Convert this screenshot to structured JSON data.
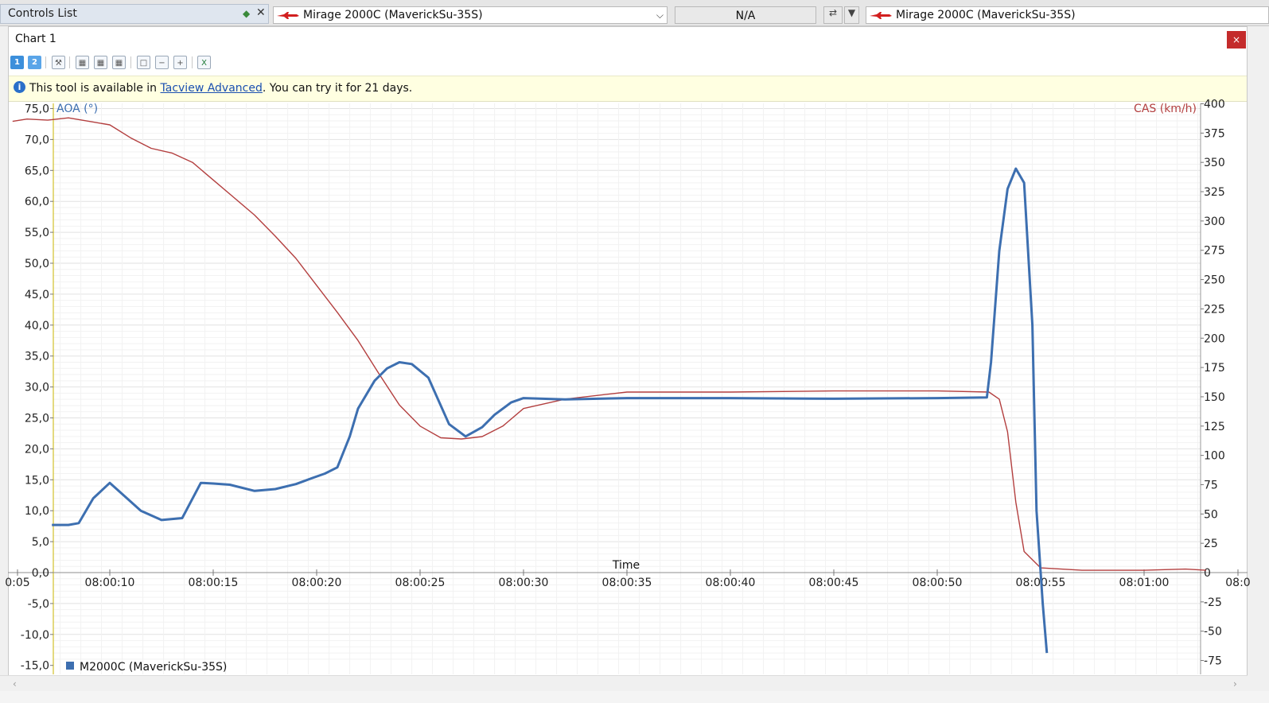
{
  "topbar": {
    "controls_title": "Controls List",
    "left_aircraft": "Mirage 2000C (MaverickSu-35S)",
    "middle_value": "N/A",
    "right_aircraft": "Mirage 2000C (MaverickSu-35S)"
  },
  "panel": {
    "title": "Chart 1",
    "close_symbol": "×"
  },
  "toolbar": {
    "btn1": "1",
    "btn2": "2"
  },
  "info": {
    "icon": "i",
    "prefix": "This tool is available in ",
    "link": "Tacview Advanced",
    "suffix": ". You can try it for 21 days."
  },
  "colors": {
    "aoa": "#3d6fb0",
    "cas": "#b33f3f",
    "grid": "#e6e6e6",
    "axis": "#9a9a9a"
  },
  "chart_data": {
    "type": "line",
    "xlabel": "Time",
    "x_ticks": [
      "0:05",
      "08:00:10",
      "08:00:15",
      "08:00:20",
      "08:00:25",
      "08:00:30",
      "08:00:35",
      "08:00:40",
      "08:00:45",
      "08:00:50",
      "08:00:55",
      "08:01:00",
      "08:0"
    ],
    "left_axis": {
      "label": "AOA (°)",
      "ylim": [
        -15,
        75
      ],
      "ticks": [
        "75,0",
        "70,0",
        "65,0",
        "60,0",
        "55,0",
        "50,0",
        "45,0",
        "40,0",
        "35,0",
        "30,0",
        "25,0",
        "20,0",
        "15,0",
        "10,0",
        "5,0",
        "0,0",
        "-5,0",
        "-10,0",
        "-15,0"
      ]
    },
    "right_axis": {
      "label": "CAS (km/h)",
      "ylim": [
        -75,
        400
      ],
      "ticks": [
        "400",
        "375",
        "350",
        "325",
        "300",
        "275",
        "250",
        "225",
        "200",
        "175",
        "150",
        "125",
        "100",
        "75",
        "50",
        "25",
        "0",
        "-25",
        "-50",
        "-75"
      ]
    },
    "legend": {
      "name": "M2000C (MaverickSu-35S)",
      "placement": "bottom-left"
    },
    "series": [
      {
        "name": "AOA (°)",
        "axis": "left",
        "x": [
          7.2,
          8,
          8.5,
          9.2,
          10,
          10.5,
          11.5,
          12.5,
          13.5,
          14.4,
          15,
          15.8,
          17,
          18,
          19,
          19.8,
          20.4,
          21,
          21.6,
          22,
          22.8,
          23.4,
          24,
          24.6,
          25.4,
          25.8,
          26.4,
          27.2,
          28,
          28.6,
          29.4,
          30,
          32,
          35,
          40,
          45,
          50,
          52.4,
          52.6,
          53,
          53.4,
          53.8,
          54.2,
          54.6,
          54.8,
          55.1,
          55.3
        ],
        "y": [
          7.7,
          7.7,
          8,
          12,
          14.5,
          13,
          10,
          8.5,
          8.8,
          14.5,
          14.4,
          14.2,
          13.2,
          13.5,
          14.3,
          15.3,
          16,
          17,
          22,
          26.5,
          31,
          33,
          34,
          33.7,
          31.5,
          28.5,
          24,
          22,
          23.5,
          25.5,
          27.5,
          28.2,
          28,
          28.2,
          28.2,
          28.1,
          28.2,
          28.3,
          34,
          52,
          62,
          65.3,
          63,
          40,
          10,
          -5,
          -13
        ]
      },
      {
        "name": "CAS (km/h)",
        "axis": "right",
        "x": [
          5.3,
          6,
          7,
          8,
          9,
          10,
          11,
          12,
          13,
          14,
          15,
          16,
          17,
          18,
          19,
          20,
          21,
          22,
          23,
          24,
          25,
          26,
          27,
          28,
          29,
          30,
          32,
          35,
          40,
          45,
          50,
          52.5,
          53,
          53.4,
          53.8,
          54.2,
          55,
          57,
          60,
          62,
          63
        ],
        "y": [
          385,
          387,
          386,
          388,
          385,
          382,
          371,
          362,
          358,
          350,
          335,
          320,
          305,
          287,
          268,
          245,
          222,
          198,
          170,
          143,
          125,
          115,
          114,
          116,
          125,
          140,
          148,
          154,
          154,
          155,
          155,
          154,
          148,
          120,
          60,
          18,
          4,
          2,
          2,
          3,
          2
        ]
      }
    ]
  }
}
